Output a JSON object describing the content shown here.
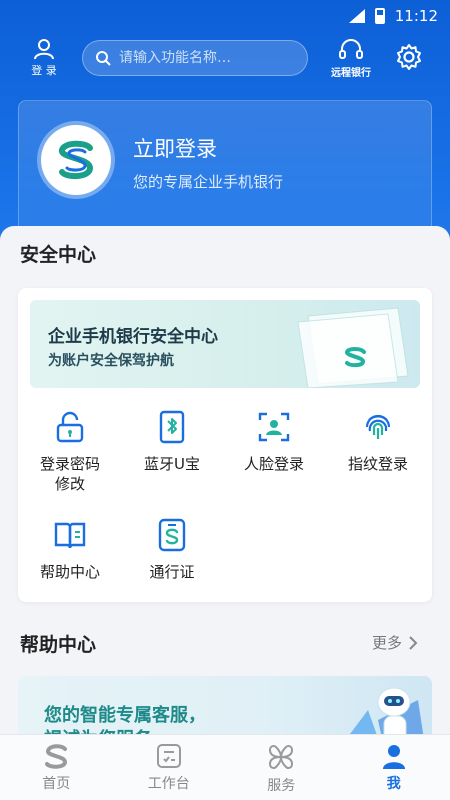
{
  "status_bar": {
    "time": "11:12"
  },
  "top_bar": {
    "login_label": "登 录",
    "search_placeholder": "请输入功能名称…",
    "remote_bank_label": "远程银行"
  },
  "login_card": {
    "title": "立即登录",
    "subtitle": "您的专属企业手机银行"
  },
  "security_center": {
    "title": "安全中心",
    "banner_title": "企业手机银行安全中心",
    "banner_subtitle": "为账户安全保驾护航",
    "items": [
      {
        "label": "登录密码\n修改",
        "icon": "unlock-icon"
      },
      {
        "label": "蓝牙U宝",
        "icon": "bluetooth-key-icon"
      },
      {
        "label": "人脸登录",
        "icon": "face-scan-icon"
      },
      {
        "label": "指纹登录",
        "icon": "fingerprint-icon"
      },
      {
        "label": "帮助中心",
        "icon": "book-icon"
      },
      {
        "label": "通行证",
        "icon": "pass-card-icon"
      }
    ]
  },
  "help_center": {
    "title": "帮助中心",
    "more_label": "更多",
    "banner_text_1": "您的智能专属客服，",
    "banner_text_2": "竭诚为您服务"
  },
  "bottom_nav": {
    "items": [
      {
        "label": "首页",
        "icon": "home-logo-icon",
        "active": false
      },
      {
        "label": "工作台",
        "icon": "workbench-icon",
        "active": false
      },
      {
        "label": "服务",
        "icon": "services-icon",
        "active": false
      },
      {
        "label": "我",
        "icon": "person-icon",
        "active": true
      }
    ]
  },
  "colors": {
    "brand_blue": "#1a73e8",
    "icon_blue": "#1a6fe0",
    "teal": "#1e8a8a"
  }
}
